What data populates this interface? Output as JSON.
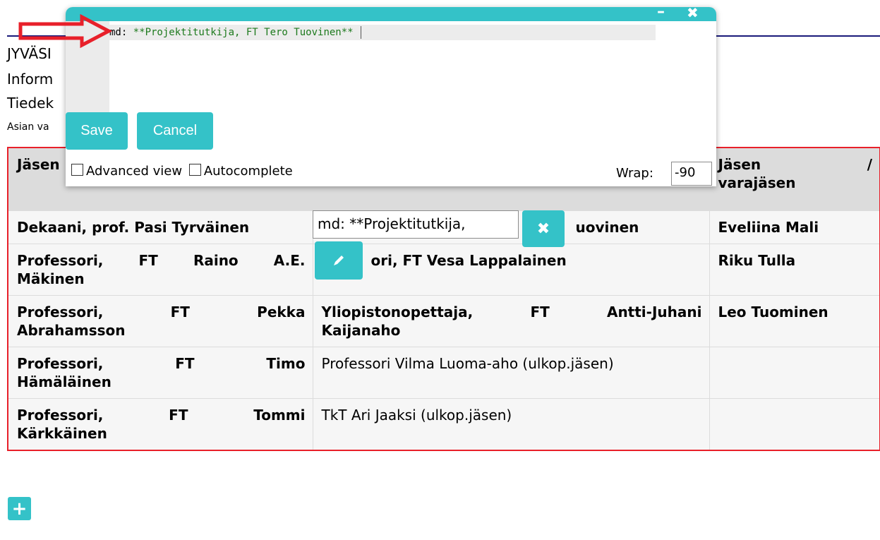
{
  "background": {
    "lines": [
      "JYVÄSI",
      "Inform",
      "Tiedek"
    ],
    "small_line": "Asian va",
    "table": {
      "headers": [
        "Jäsen",
        "",
        "Jäsen /\nvarajäsen"
      ],
      "header_right_a": "Jäsen",
      "header_right_b": "/",
      "header_right_c": "varajäsen",
      "rows": [
        {
          "c1": "Dekaani, prof. Pasi Tyrväinen",
          "c2": "uovinen",
          "c3": "Eveliina Mali"
        },
        {
          "c1a": [
            "Professori,",
            "FT",
            "Raino",
            "A.E."
          ],
          "c1b": "Mäkinen",
          "c2": "ori, FT Vesa Lappalainen",
          "c3": "Riku Tulla"
        },
        {
          "c1a": [
            "Professori,",
            "FT",
            "Pekka"
          ],
          "c1b": "Abrahamsson",
          "c2a": [
            "Yliopistonopettaja,",
            "FT",
            "Antti-Juhani"
          ],
          "c2b": "Kaijanaho",
          "c3": "Leo Tuominen"
        },
        {
          "c1a": [
            "Professori,",
            "FT",
            "Timo"
          ],
          "c1b": "Hämäläinen",
          "c2": "Professori Vilma Luoma-aho (ulkop.jäsen)",
          "c3": ""
        },
        {
          "c1a": [
            "Professori,",
            "FT",
            "Tommi"
          ],
          "c1b": "Kärkkäinen",
          "c2": "TkT Ari Jaaksi (ulkop.jäsen)",
          "c3": ""
        }
      ]
    },
    "inline_input_value": "md: **Projektitutkija, ",
    "add_icon": "plus-icon",
    "close_icon": "close-icon",
    "edit_icon": "pencil-icon"
  },
  "editor": {
    "minimize": "–",
    "close": "✖",
    "code_prefix": "md: ",
    "code_value": "**Projektitutkija, FT Tero Tuovinen**",
    "save_label": "Save",
    "cancel_label": "Cancel",
    "advanced_view_label": "Advanced view",
    "autocomplete_label": "Autocomplete",
    "wrap_label": "Wrap:",
    "wrap_value": "-90"
  },
  "colors": {
    "accent": "#34c2c8",
    "border_red": "#e8202a",
    "arrow_red": "#e8202a"
  }
}
